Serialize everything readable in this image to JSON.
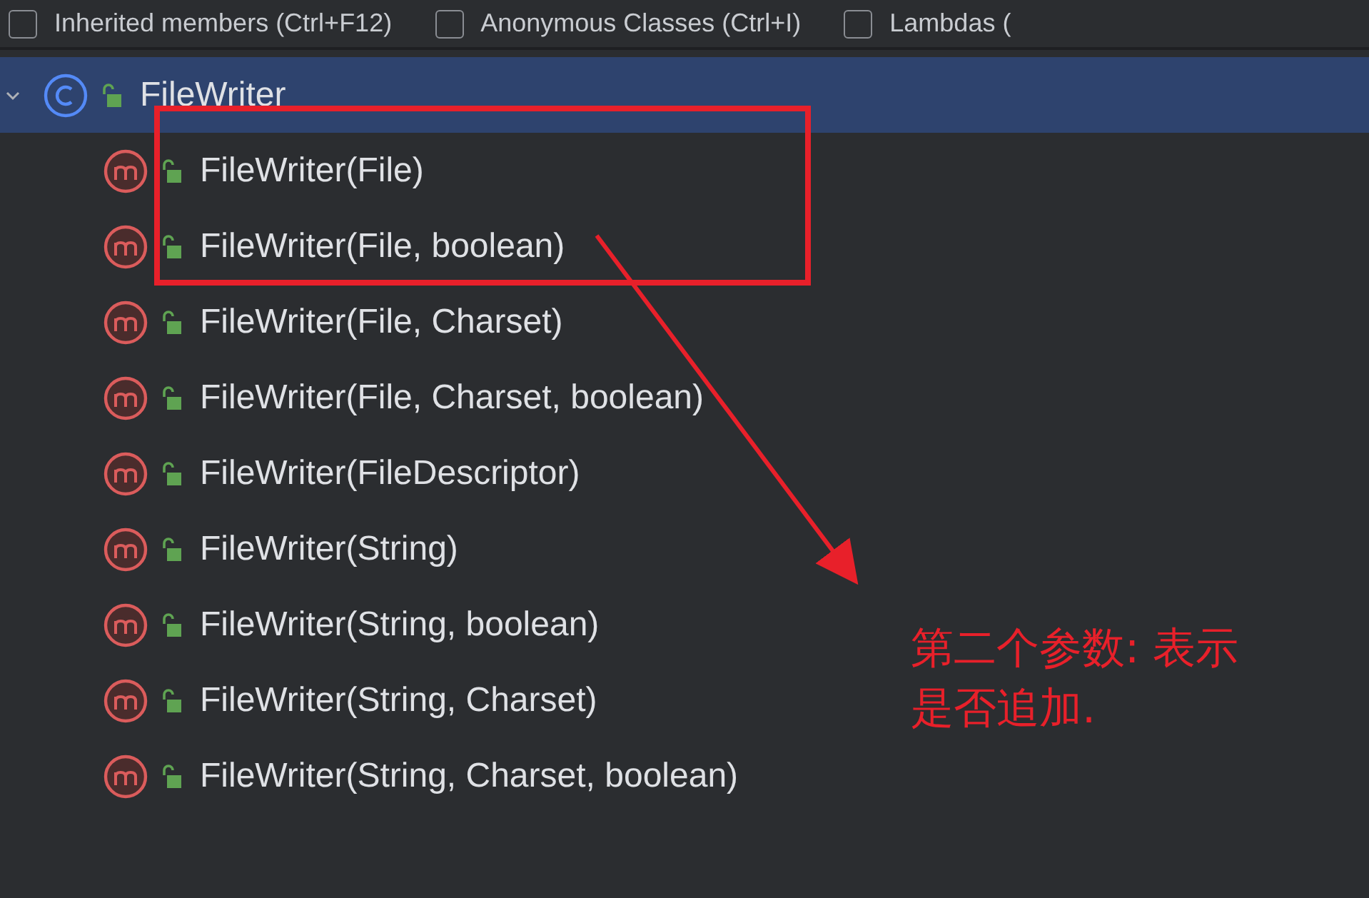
{
  "filter_bar": {
    "options": [
      {
        "label": "Inherited members (Ctrl+F12)",
        "checked": false
      },
      {
        "label": "Anonymous Classes (Ctrl+I)",
        "checked": false
      },
      {
        "label": "Lambdas (",
        "checked": false
      }
    ]
  },
  "tree": {
    "root": {
      "label": "FileWriter",
      "kind": "class",
      "expanded": true,
      "selected": true,
      "children": [
        {
          "label": "FileWriter(File)",
          "kind": "method"
        },
        {
          "label": "FileWriter(File, boolean)",
          "kind": "method"
        },
        {
          "label": "FileWriter(File, Charset)",
          "kind": "method"
        },
        {
          "label": "FileWriter(File, Charset, boolean)",
          "kind": "method"
        },
        {
          "label": "FileWriter(FileDescriptor)",
          "kind": "method"
        },
        {
          "label": "FileWriter(String)",
          "kind": "method"
        },
        {
          "label": "FileWriter(String, boolean)",
          "kind": "method"
        },
        {
          "label": "FileWriter(String, Charset)",
          "kind": "method"
        },
        {
          "label": "FileWriter(String, Charset, boolean)",
          "kind": "method"
        }
      ]
    }
  },
  "annotation": {
    "lines": [
      "第二个参数: 表示",
      "是否追加."
    ]
  }
}
